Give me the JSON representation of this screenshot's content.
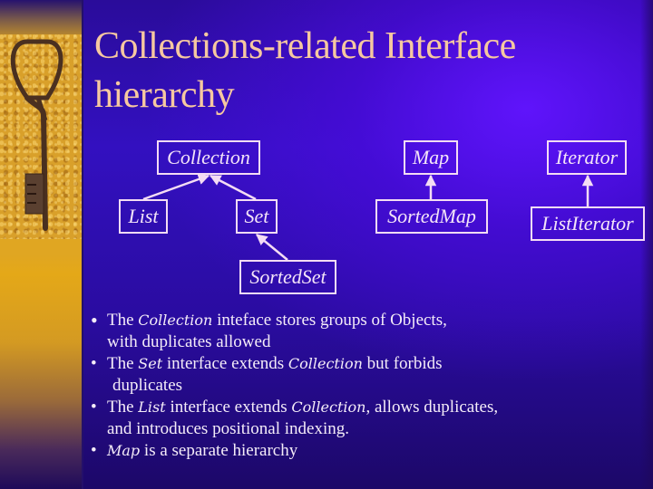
{
  "slide": {
    "title": "Collections-related Interface hierarchy",
    "decoration": {
      "left_image": "rusty-key-on-sand",
      "accent_colors": {
        "background": "#2a0ca0",
        "title_text": "#f6c8a0",
        "body_text": "#f4ecf8",
        "box_border": "#f4dcf4",
        "sand": "#e0a622"
      }
    }
  },
  "diagram": {
    "nodes": [
      {
        "id": "collection",
        "label": "Collection"
      },
      {
        "id": "list",
        "label": "List"
      },
      {
        "id": "set",
        "label": "Set"
      },
      {
        "id": "sortedset",
        "label": "SortedSet"
      },
      {
        "id": "map",
        "label": "Map"
      },
      {
        "id": "sortedmap",
        "label": "SortedMap"
      },
      {
        "id": "iterator",
        "label": "Iterator"
      },
      {
        "id": "listiterator",
        "label": "ListIterator"
      }
    ],
    "edges": [
      {
        "from": "list",
        "to": "collection",
        "type": "extends"
      },
      {
        "from": "set",
        "to": "collection",
        "type": "extends"
      },
      {
        "from": "sortedset",
        "to": "set",
        "type": "extends"
      },
      {
        "from": "sortedmap",
        "to": "map",
        "type": "extends"
      },
      {
        "from": "listiterator",
        "to": "iterator",
        "type": "extends"
      }
    ]
  },
  "bullets": [
    {
      "bullet_char": "•",
      "parts": [
        {
          "text": "The ",
          "italic": false
        },
        {
          "text": "Collection",
          "italic": true
        },
        {
          "text": " inteface stores groups of Objects,",
          "italic": false
        }
      ],
      "continuation": "with duplicates allowed"
    },
    {
      "bullet_char": "•",
      "parts": [
        {
          "text": "The ",
          "italic": false
        },
        {
          "text": "Set",
          "italic": true
        },
        {
          "text": " interface extends ",
          "italic": false
        },
        {
          "text": "Collection",
          "italic": true
        },
        {
          "text": " but forbids",
          "italic": false
        }
      ],
      "continuation": "duplicates"
    },
    {
      "bullet_char": "•",
      "parts": [
        {
          "text": "The ",
          "italic": false
        },
        {
          "text": "List",
          "italic": true
        },
        {
          "text": " interface extends ",
          "italic": false
        },
        {
          "text": "Collection",
          "italic": true
        },
        {
          "text": ", allows duplicates,",
          "italic": false
        }
      ],
      "continuation": "and introduces positional indexing."
    },
    {
      "bullet_char": "•",
      "parts": [
        {
          "text": "Map",
          "italic": true
        },
        {
          "text": " is a separate hierarchy",
          "italic": false
        }
      ],
      "continuation": ""
    }
  ]
}
